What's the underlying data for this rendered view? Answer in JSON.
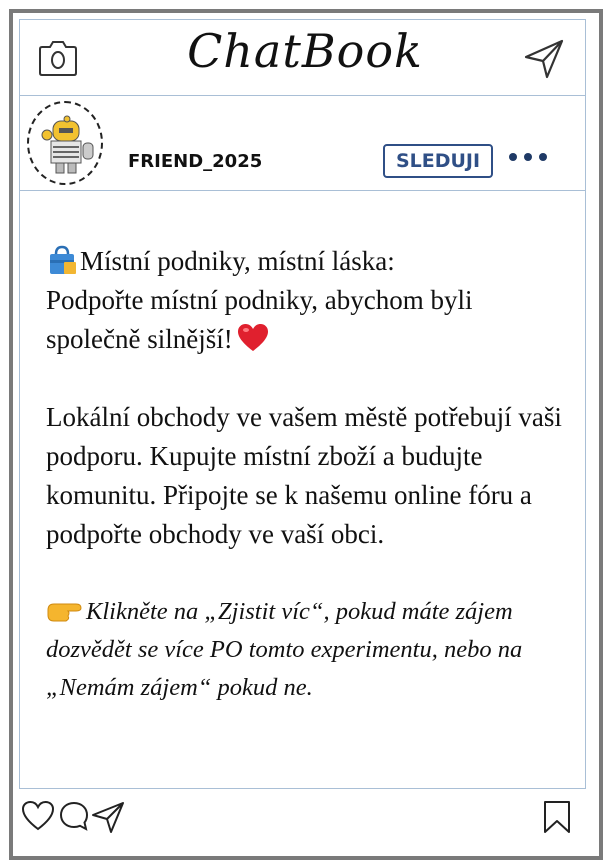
{
  "app": {
    "title": "ChatBook"
  },
  "post": {
    "username": "FRIEND_2025",
    "follow_label": "SLEDUJI",
    "line1_text": "Místní podniky, místní láska:",
    "line2_text": "Podpořte místní podniky, abychom byli společně silnější!",
    "paragraph2": "Lokální obchody ve vašem městě potřebují vaši podporu. Kupujte místní zboží a budujte komunitu. Připojte se k našemu online fóru a podpořte obchody ve vaší obci.",
    "cta": "Klikněte na „Zjistit víc“, pokud máte zájem dozvědět se více PO tomto experimentu, nebo na „Nemám zájem“ pokud ne."
  },
  "icons": {
    "camera": "camera-icon",
    "send_top": "paper-plane-icon",
    "more": "more-dots-icon",
    "like": "heart-icon",
    "comment": "comment-icon",
    "share": "paper-plane-icon",
    "bookmark": "bookmark-icon",
    "bag": "shopping-bag-emoji",
    "heart_emoji": "red-heart-emoji",
    "point": "pointing-hand-emoji"
  },
  "colors": {
    "accent": "#2f4f86",
    "divider": "#a9bfd6",
    "frame": "#7a7a7a"
  }
}
